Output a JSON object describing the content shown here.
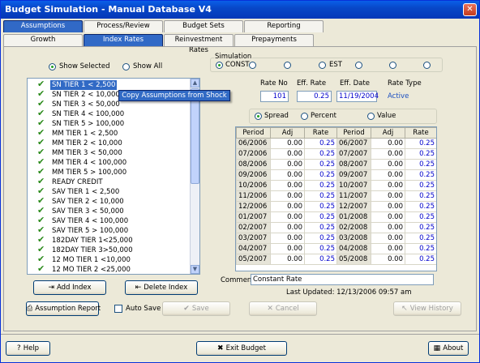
{
  "window": {
    "title": "Budget Simulation - Manual Database V4"
  },
  "main_tabs": [
    "Assumptions",
    "Process/Review",
    "Budget Sets",
    "Reporting"
  ],
  "sub_tabs": [
    "Growth",
    "Index Rates",
    "Reinvestment Rates",
    "Prepayments"
  ],
  "filter": {
    "show_selected": "Show Selected",
    "show_all": "Show All"
  },
  "list_items": [
    "SN TIER 1 < 2,500",
    "SN TIER 2 < 10,000",
    "SN TIER 3 < 50,000",
    "SN TIER 4 < 100,000",
    "SN TIER 5 > 100,000",
    "MM TIER 1 < 2,500",
    "MM TIER 2 < 10,000",
    "MM TIER 3 < 50,000",
    "MM TIER 4 < 100,000",
    "MM TIER 5 > 100,000",
    "READY CREDIT",
    "SAV TIER 1 < 2,500",
    "SAV TIER 2 < 10,000",
    "SAV TIER 3 < 50,000",
    "SAV TIER 4 < 100,000",
    "SAV TIER 5 > 100,000",
    "182DAY TIER 1<25,000",
    "182DAY TIER 3>50,000",
    "12 MO TIER 1 <10,000",
    "12 MO TIER 2 <25,000"
  ],
  "context_menu": {
    "item": "Copy Assumptions from Shock"
  },
  "simulation": {
    "group_label": "Simulation",
    "const": "CONST",
    "est": "EST"
  },
  "rate_fields": {
    "rate_no_label": "Rate No",
    "rate_no": "101",
    "eff_rate_label": "Eff. Rate",
    "eff_rate": "0.25",
    "eff_date_label": "Eff. Date",
    "eff_date": "11/19/2004",
    "rate_type_label": "Rate Type",
    "rate_type": "Active"
  },
  "mode": {
    "spread": "Spread",
    "percent": "Percent",
    "value": "Value"
  },
  "grid": {
    "headers": [
      "Period",
      "Adj",
      "Rate",
      "Period",
      "Adj",
      "Rate"
    ],
    "rows": [
      [
        "06/2006",
        "0.00",
        "0.25",
        "06/2007",
        "0.00",
        "0.25"
      ],
      [
        "07/2006",
        "0.00",
        "0.25",
        "07/2007",
        "0.00",
        "0.25"
      ],
      [
        "08/2006",
        "0.00",
        "0.25",
        "08/2007",
        "0.00",
        "0.25"
      ],
      [
        "09/2006",
        "0.00",
        "0.25",
        "09/2007",
        "0.00",
        "0.25"
      ],
      [
        "10/2006",
        "0.00",
        "0.25",
        "10/2007",
        "0.00",
        "0.25"
      ],
      [
        "11/2006",
        "0.00",
        "0.25",
        "11/2007",
        "0.00",
        "0.25"
      ],
      [
        "12/2006",
        "0.00",
        "0.25",
        "12/2007",
        "0.00",
        "0.25"
      ],
      [
        "01/2007",
        "0.00",
        "0.25",
        "01/2008",
        "0.00",
        "0.25"
      ],
      [
        "02/2007",
        "0.00",
        "0.25",
        "02/2008",
        "0.00",
        "0.25"
      ],
      [
        "03/2007",
        "0.00",
        "0.25",
        "03/2008",
        "0.00",
        "0.25"
      ],
      [
        "04/2007",
        "0.00",
        "0.25",
        "04/2008",
        "0.00",
        "0.25"
      ],
      [
        "05/2007",
        "0.00",
        "0.25",
        "05/2008",
        "0.00",
        "0.25"
      ]
    ]
  },
  "comment": {
    "label": "Comment:",
    "value": "Constant Rate"
  },
  "last_updated": "Last Updated: 12/13/2006 09:57 am",
  "buttons": {
    "add_index": "Add Index",
    "delete_index": "Delete Index",
    "assumption_report": "Assumption Report",
    "auto_save": "Auto Save",
    "save": "Save",
    "cancel": "Cancel",
    "view_history": "View History",
    "help": "Help",
    "exit_budget": "Exit Budget",
    "about": "About"
  }
}
